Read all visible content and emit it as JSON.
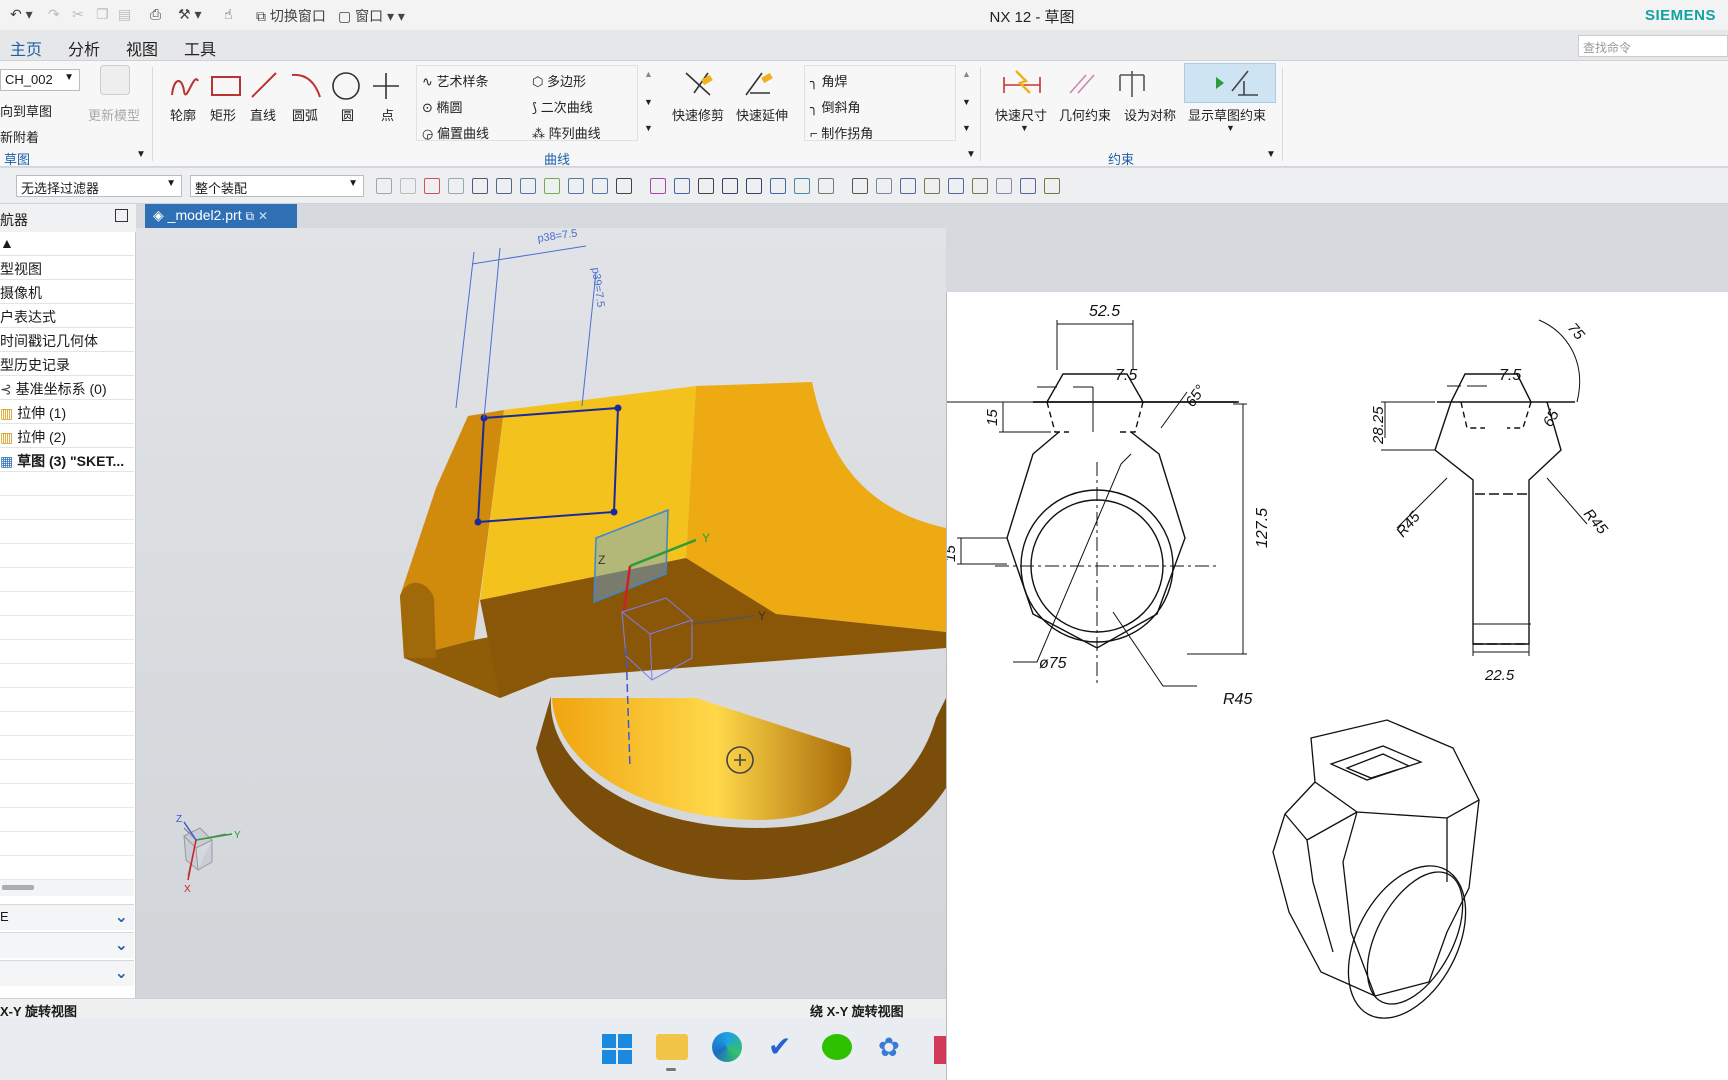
{
  "window": {
    "title": "NX 12 - 草图",
    "brand": "SIEMENS",
    "switch_window": "切换窗口",
    "window_menu": "窗口"
  },
  "menu": {
    "tabs": [
      "主页",
      "分析",
      "视图",
      "工具"
    ],
    "search_placeholder": "查找命令"
  },
  "ribbon": {
    "sketch_group": {
      "combo_value": "CH_002",
      "item1": "向到草图",
      "item2": "新附着",
      "update_model": "更新模型",
      "label": "草图"
    },
    "curve_tools": [
      "轮廓",
      "矩形",
      "直线",
      "圆弧",
      "圆",
      "点"
    ],
    "curve_col1": [
      "艺术样条",
      "椭圆",
      "偏置曲线"
    ],
    "curve_col2": [
      "多边形",
      "二次曲线",
      "阵列曲线"
    ],
    "curve_edit": [
      "快速修剪",
      "快速延伸"
    ],
    "curve_col3": [
      "角焊",
      "倒斜角",
      "制作拐角"
    ],
    "curve_label": "曲线",
    "constraint_tools": [
      "快速尺寸",
      "几何约束",
      "设为对称",
      "显示草图约束"
    ],
    "constraint_label": "约束"
  },
  "filterbar": {
    "filter": "无选择过滤器",
    "scope": "整个装配"
  },
  "navigator": {
    "title": "航器",
    "items": [
      "型视图",
      "摄像机",
      "户表达式",
      "时间戳记几何体",
      "型历史记录",
      "基准坐标系 (0)",
      "拉伸 (1)",
      "拉伸 (2)",
      "草图 (3) \"SKET..."
    ],
    "panels": [
      "E",
      "",
      ""
    ]
  },
  "document": {
    "tab": "_model2.prt"
  },
  "viewport": {
    "dim_h": "p38=7.5",
    "dim_v": "p39=7.5",
    "axis_y": "Y",
    "axis_z": "Z",
    "triad": {
      "x": "X",
      "y": "Y",
      "z": "Z"
    }
  },
  "status": {
    "left": "X-Y 旋转视图",
    "right": "绕 X-Y 旋转视图"
  },
  "colors": {
    "accent": "#1c5fa8",
    "brand": "#0fa3a3",
    "part_gold": "#f0b21c",
    "part_dark": "#8a5a08"
  },
  "drawing": {
    "front_dims": [
      "52.5",
      "7.5",
      "15",
      "65°",
      "127.5",
      "15",
      "ø75",
      "R45"
    ],
    "side_dims": [
      "7.5",
      "75",
      "28.25",
      "65",
      "R45",
      "R45",
      "22.5"
    ]
  }
}
